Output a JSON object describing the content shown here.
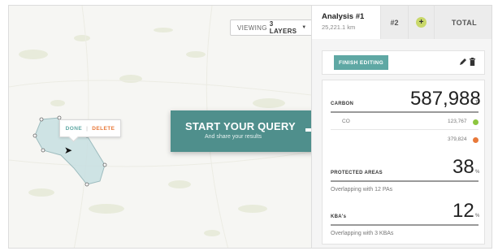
{
  "map": {
    "layers_prefix": "VIEWING",
    "layers_count": "3 LAYERS",
    "popup_done": "DONE",
    "popup_separator": "|",
    "popup_delete": "DELETE"
  },
  "query_banner": {
    "title": "START YOUR QUERY",
    "subtitle": "And share your results",
    "arrow_icon": "arrow-right-icon"
  },
  "tabs": {
    "active_title": "Analysis #1",
    "active_subtitle": "25,221.1 km",
    "second": "#2",
    "add": "+",
    "total": "TOTAL"
  },
  "editing": {
    "finish_label": "FINISH EDITING",
    "tools": [
      "pencil-icon",
      "trash-icon"
    ]
  },
  "metrics": {
    "carbon": {
      "label": "CARBON",
      "value": "587,988",
      "unit": "T",
      "row1_label": "CO",
      "row1_value": "123,767",
      "row1_color": "#8dc63f",
      "row2_value": "379,824",
      "row2_color": "#e8793a"
    },
    "protected": {
      "label": "PROTECTED AREAS",
      "value": "38",
      "unit": "%",
      "note": "Overlapping with 12 PAs"
    },
    "kba": {
      "label": "KBA's",
      "value": "12",
      "unit": "%",
      "note": "Overlapping with 3 KBAs"
    }
  },
  "colors": {
    "accent": "#4f8f8c",
    "accent_light": "#5fa8a4",
    "delete": "#e8793a",
    "add_tab": "#c9d86a"
  }
}
